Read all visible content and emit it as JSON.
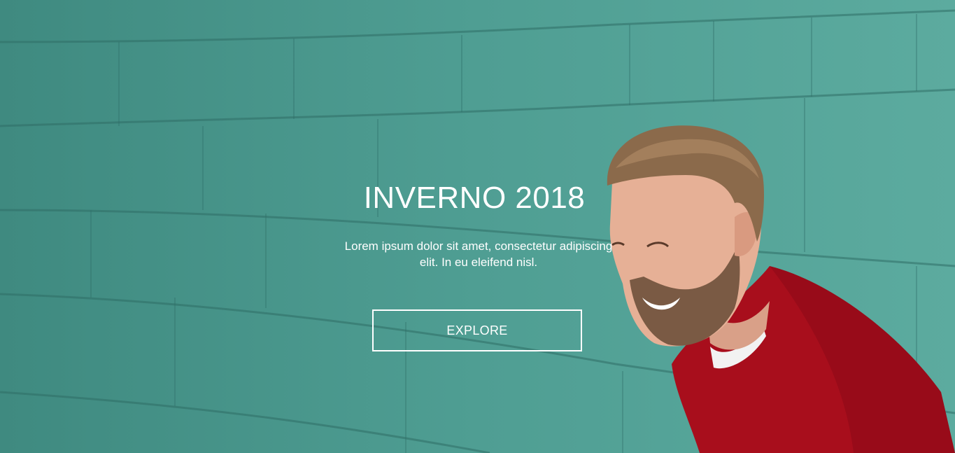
{
  "hero": {
    "title": "INVERNO 2018",
    "subtitle": "Lorem ipsum dolor sit amet, consectetur adipiscing elit. In eu eleifend nisl.",
    "cta_label": "EXPLORE"
  },
  "colors": {
    "wall": "#4f9a90",
    "text": "#ffffff",
    "sweater": "#b0101e",
    "hair": "#8a6a4a",
    "skin": "#e8b49a"
  },
  "icons": {
    "background": "photo-man-smiling-teal-wall"
  }
}
